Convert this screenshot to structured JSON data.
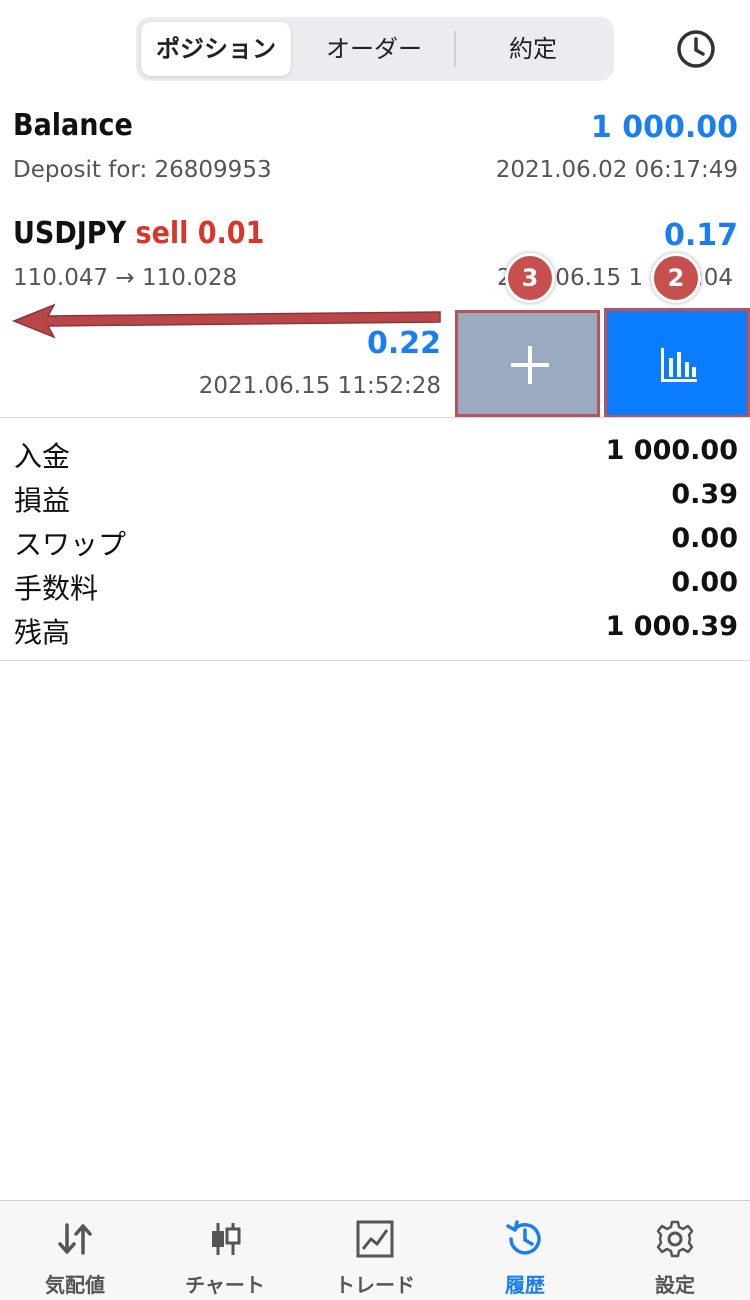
{
  "header": {
    "tabs": [
      {
        "label": "ポジション",
        "active": true
      },
      {
        "label": "オーダー",
        "active": false
      },
      {
        "label": "約定",
        "active": false
      }
    ],
    "history_icon": "clock-icon"
  },
  "balance": {
    "title": "Balance",
    "value": "1 000.00",
    "subtitle": "Deposit for: 26809953",
    "timestamp": "2021.06.02 06:17:49"
  },
  "trade": {
    "symbol": "USDJPY",
    "side": "sell 0.01",
    "profit": "0.17",
    "prices": "110.047 → 110.028",
    "timestamp_visible": "2",
    "timestamp_mid": ".06.15 1",
    "timestamp_end": ":04"
  },
  "swiped_row": {
    "value": "0.22",
    "timestamp": "2021.06.15 11:52:28"
  },
  "actions": {
    "add_icon": "plus-icon",
    "chart_icon": "bar-chart-icon",
    "badge_add": "3",
    "badge_chart": "2"
  },
  "summary": [
    {
      "label": "入金",
      "value": "1 000.00"
    },
    {
      "label": "損益",
      "value": "0.39"
    },
    {
      "label": "スワップ",
      "value": "0.00"
    },
    {
      "label": "手数料",
      "value": "0.00"
    },
    {
      "label": "残高",
      "value": "1 000.39"
    }
  ],
  "tabbar": [
    {
      "label": "気配値",
      "icon": "quotes-arrows-icon",
      "active": false
    },
    {
      "label": "チャート",
      "icon": "candlestick-icon",
      "active": false
    },
    {
      "label": "トレード",
      "icon": "trade-line-icon",
      "active": false
    },
    {
      "label": "履歴",
      "icon": "history-icon",
      "active": true
    },
    {
      "label": "設定",
      "icon": "gear-icon",
      "active": false
    }
  ],
  "colors": {
    "accent": "#1a7ef0",
    "sell": "#d9362b",
    "annotation": "#c7504f"
  }
}
